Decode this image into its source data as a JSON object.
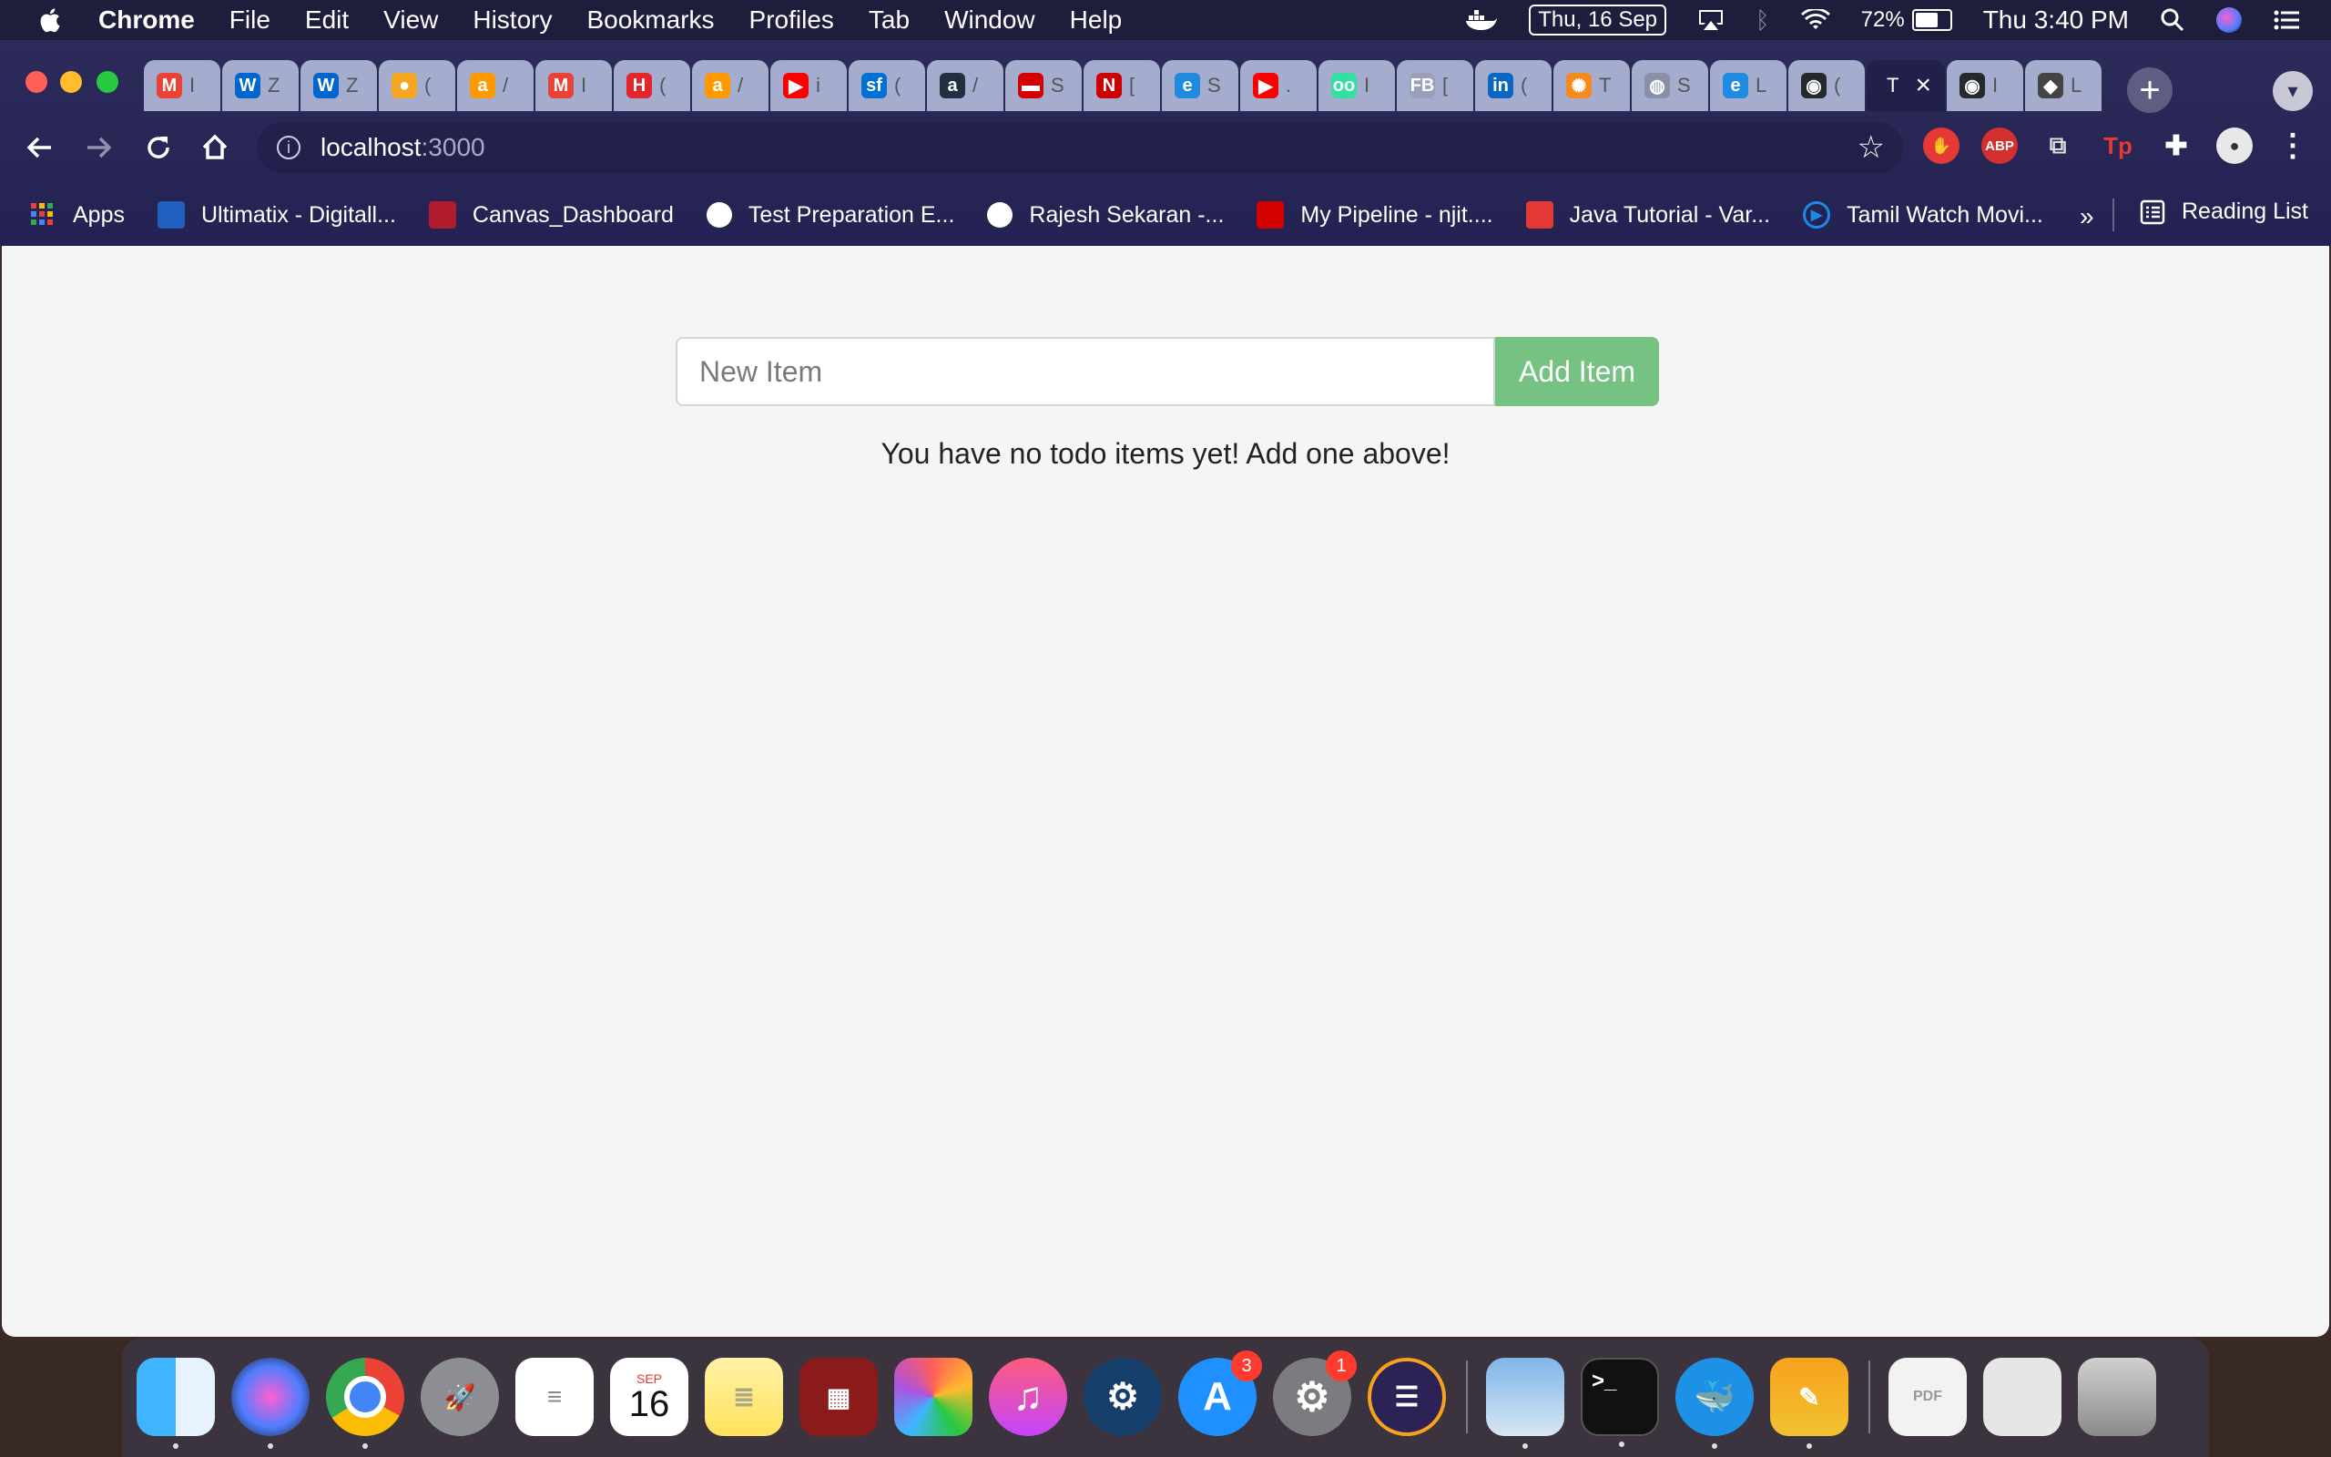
{
  "menubar": {
    "app_name": "Chrome",
    "items": [
      "File",
      "Edit",
      "View",
      "History",
      "Bookmarks",
      "Profiles",
      "Tab",
      "Window",
      "Help"
    ],
    "date": "Thu, 16 Sep",
    "battery_percent": "72%",
    "battery_level": 0.72,
    "clock": "Thu 3:40 PM"
  },
  "tabs": [
    {
      "favicon": "gmail-icon",
      "title": "I",
      "color": "#ea4335",
      "glyph": "M"
    },
    {
      "favicon": "workday-icon",
      "title": "Z",
      "color": "#0066cc",
      "glyph": "W"
    },
    {
      "favicon": "workday-icon",
      "title": "Z",
      "color": "#0066cc",
      "glyph": "W"
    },
    {
      "favicon": "firebase-icon",
      "title": "(",
      "color": "#f5a623",
      "glyph": "●"
    },
    {
      "favicon": "amazon-icon",
      "title": "/",
      "color": "#ff9900",
      "glyph": "a"
    },
    {
      "favicon": "gmail-icon",
      "title": "I",
      "color": "#ea4335",
      "glyph": "M"
    },
    {
      "favicon": "hackerrank-icon",
      "title": "(",
      "color": "#e4252b",
      "glyph": "H"
    },
    {
      "favicon": "amazon-icon",
      "title": "/",
      "color": "#ff9900",
      "glyph": "a"
    },
    {
      "favicon": "youtube-icon",
      "title": "i",
      "color": "#ff0000",
      "glyph": "▶"
    },
    {
      "favicon": "salesforce-icon",
      "title": "(",
      "color": "#0070d2",
      "glyph": "sf"
    },
    {
      "favicon": "amazon-icon",
      "title": "/",
      "color": "#232f3e",
      "glyph": "a"
    },
    {
      "favicon": "pipeline-icon",
      "title": "S",
      "color": "#d40000",
      "glyph": "▬"
    },
    {
      "favicon": "njit-icon",
      "title": "[",
      "color": "#cc0000",
      "glyph": "N"
    },
    {
      "favicon": "edge-icon",
      "title": "S",
      "color": "#1f8be0",
      "glyph": "e"
    },
    {
      "favicon": "youtube-icon",
      "title": ".",
      "color": "#ff0000",
      "glyph": "▶"
    },
    {
      "favicon": "tripadvisor-icon",
      "title": "I",
      "color": "#34e0a1",
      "glyph": "oo"
    },
    {
      "favicon": "fb-icon",
      "title": "[",
      "color": "#9aa0b8",
      "glyph": "FB"
    },
    {
      "favicon": "linkedin-icon",
      "title": "(",
      "color": "#0a66c2",
      "glyph": "in"
    },
    {
      "favicon": "sun-icon",
      "title": "T",
      "color": "#f58a1f",
      "glyph": "✺"
    },
    {
      "favicon": "globe-icon",
      "title": "S",
      "color": "#8a8fa8",
      "glyph": "◍"
    },
    {
      "favicon": "edge-icon",
      "title": "L",
      "color": "#1f8be0",
      "glyph": "e"
    },
    {
      "favicon": "github-icon",
      "title": "(",
      "color": "#24292e",
      "glyph": "◉"
    },
    {
      "favicon": "",
      "title": "T",
      "color": "#20204a",
      "glyph": "",
      "active": true
    },
    {
      "favicon": "github-icon",
      "title": "I",
      "color": "#24292e",
      "glyph": "◉"
    },
    {
      "favicon": "bird-icon",
      "title": "L",
      "color": "#444",
      "glyph": "◆"
    }
  ],
  "omnibox": {
    "host": "localhost",
    "port": ":3000"
  },
  "bookmarks": [
    {
      "label": "Apps",
      "icon": "apps-grid-icon",
      "color": "#e94235"
    },
    {
      "label": "Ultimatix - Digitall...",
      "icon": "tata-icon",
      "color": "#1f5fbf"
    },
    {
      "label": "Canvas_Dashboard",
      "icon": "njit-icon",
      "color": "#b01c2e"
    },
    {
      "label": "Test Preparation E...",
      "icon": "globe-icon",
      "color": "#ffffff"
    },
    {
      "label": "Rajesh Sekaran -...",
      "icon": "globe-icon",
      "color": "#ffffff"
    },
    {
      "label": "My Pipeline - njit....",
      "icon": "pipeline-icon",
      "color": "#d40000"
    },
    {
      "label": "Java Tutorial - Var...",
      "icon": "chevron-right-icon",
      "color": "#e53935"
    },
    {
      "label": "Tamil Watch Movi...",
      "icon": "play-circle-icon",
      "color": "#1e88e5"
    }
  ],
  "bookmarks_more": "»",
  "reading_list": "Reading List",
  "page": {
    "input_placeholder": "New Item",
    "input_value": "",
    "add_button": "Add Item",
    "empty_message": "You have no todo items yet! Add one above!"
  },
  "dock": {
    "calendar_month": "SEP",
    "calendar_day": "16",
    "appstore_badge": "3",
    "settings_badge": "1"
  }
}
